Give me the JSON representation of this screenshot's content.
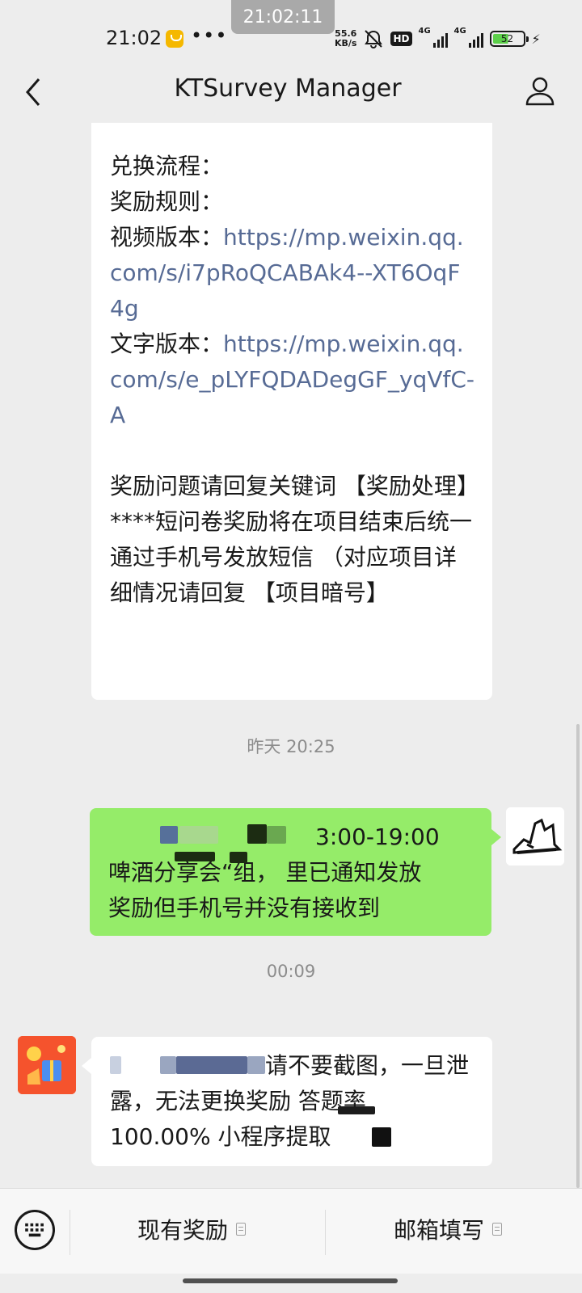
{
  "recording_timer": "21:02:11",
  "status_bar": {
    "time": "21:02",
    "dots": "•••",
    "net_speed_value": "55.6",
    "net_speed_unit": "KB/s",
    "hd_label": "HD",
    "signal1_label": "4G",
    "signal2_label": "4G",
    "battery_level": "52"
  },
  "nav": {
    "title": "KTSurvey Manager"
  },
  "messages": {
    "msg1": {
      "line_exchange": "兑换流程：",
      "line_rules": "奖励规则：",
      "video_label": "视频版本：",
      "video_link": "https://mp.weixin.qq.com/s/i7pRoQCABAk4--XT6OqF4g",
      "text_label": "文字版本：",
      "text_link": "https://mp.weixin.qq.com/s/e_pLYFQDADegGF_yqVfC-A",
      "para1": "奖励问题请回复关键词 【奖励处理】",
      "para2": "****短问卷奖励将在项目结束后统一通过手机号发放短信 （对应项目详细情况请回复 【项目暗号】"
    },
    "timestamp1": "昨天 20:25",
    "msg2": {
      "line1_visible": "3:00-19:00",
      "line2_visible": "啤酒分享会“组，  里已通知发放",
      "line3": "奖励但手机号并没有接收到"
    },
    "timestamp2": "00:09",
    "msg3": {
      "line1_visible": "请不要截图，一旦泄",
      "line2": "露，无法更换奖励 答题率",
      "line3": "100.00% 小程序提取"
    }
  },
  "bottom_menu": {
    "item1": "现有奖励",
    "item2": "邮箱填写"
  },
  "colors": {
    "chat_bg": "#ededed",
    "green_bubble": "#95ec69",
    "link": "#576b95"
  }
}
